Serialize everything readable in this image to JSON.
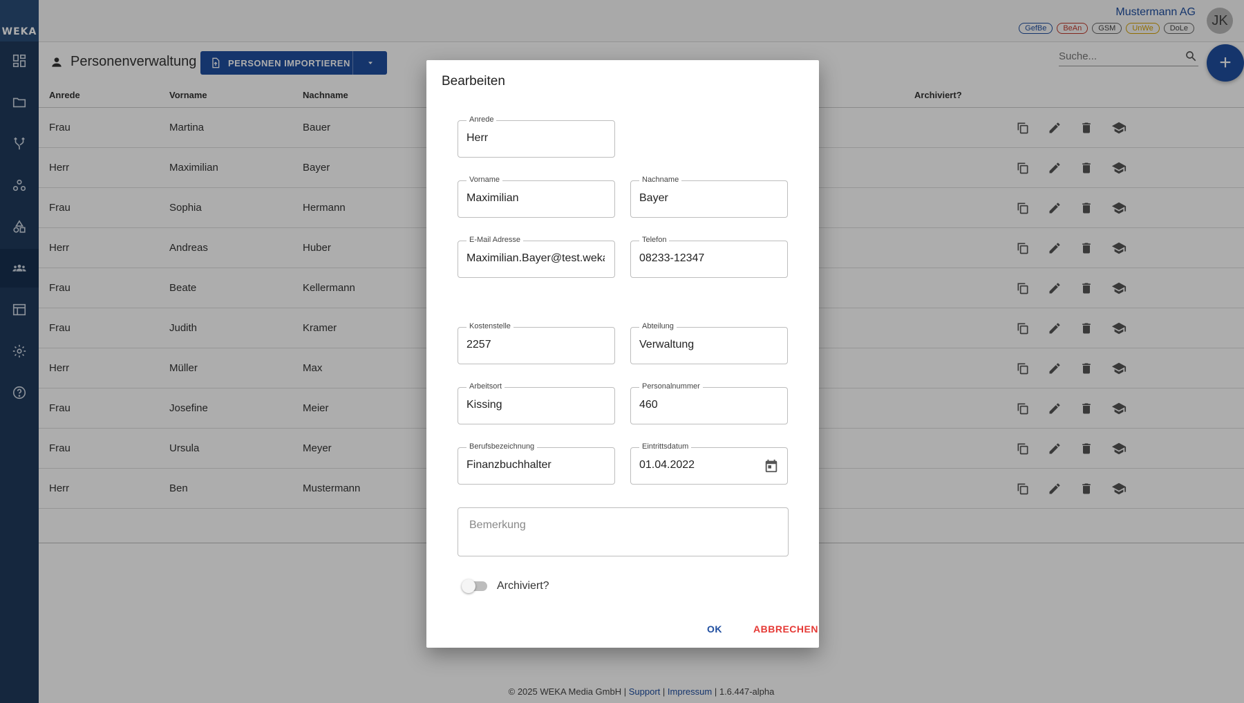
{
  "app": {
    "logo": "WEKA"
  },
  "topbar": {
    "company": "Mustermann AG",
    "badges": [
      {
        "label": "GefBe",
        "color": "#1f4ea0"
      },
      {
        "label": "BeAn",
        "color": "#c0392b"
      },
      {
        "label": "GSM",
        "color": "#444444"
      },
      {
        "label": "UnWe",
        "color": "#d4a100"
      },
      {
        "label": "DoLe",
        "color": "#444444"
      }
    ],
    "avatar": "JK"
  },
  "sidebar": {
    "items": [
      {
        "icon": "dashboard-icon"
      },
      {
        "icon": "folder-icon"
      },
      {
        "icon": "fork-icon"
      },
      {
        "icon": "bubbles-icon"
      },
      {
        "icon": "shapes-icon"
      },
      {
        "icon": "people-icon",
        "active": true
      },
      {
        "icon": "table-icon"
      },
      {
        "icon": "gear-icon"
      },
      {
        "icon": "help-icon"
      }
    ]
  },
  "header": {
    "title": "Personenverwaltung",
    "import_label": "PERSONEN IMPORTIEREN",
    "search_placeholder": "Suche..."
  },
  "table": {
    "columns": [
      "Anrede",
      "Vorname",
      "Nachname",
      "Archiviert?"
    ],
    "rows": [
      [
        "Frau",
        "Martina",
        "Bauer"
      ],
      [
        "Herr",
        "Maximilian",
        "Bayer"
      ],
      [
        "Frau",
        "Sophia",
        "Hermann"
      ],
      [
        "Herr",
        "Andreas",
        "Huber"
      ],
      [
        "Frau",
        "Beate",
        "Kellermann"
      ],
      [
        "Frau",
        "Judith",
        "Kramer"
      ],
      [
        "Herr",
        "Müller",
        "Max"
      ],
      [
        "Frau",
        "Josefine",
        "Meier"
      ],
      [
        "Frau",
        "Ursula",
        "Meyer"
      ],
      [
        "Herr",
        "Ben",
        "Mustermann"
      ]
    ]
  },
  "footer": {
    "copyright": "© 2025 WEKA Media GmbH |",
    "support": "Support",
    "sep": "|",
    "impressum": "Impressum",
    "version": "| 1.6.447-alpha"
  },
  "dialog": {
    "title": "Bearbeiten",
    "fields": {
      "anrede": {
        "label": "Anrede",
        "value": "Herr"
      },
      "vorname": {
        "label": "Vorname",
        "value": "Maximilian"
      },
      "nachname": {
        "label": "Nachname",
        "value": "Bayer"
      },
      "email": {
        "label": "E-Mail Adresse",
        "value": "Maximilian.Bayer@test.weka.de"
      },
      "telefon": {
        "label": "Telefon",
        "value": "08233-12347"
      },
      "kostenstelle": {
        "label": "Kostenstelle",
        "value": "2257"
      },
      "abteilung": {
        "label": "Abteilung",
        "value": "Verwaltung"
      },
      "arbeitsort": {
        "label": "Arbeitsort",
        "value": "Kissing"
      },
      "personalnummer": {
        "label": "Personalnummer",
        "value": "460"
      },
      "berufsbezeichnung": {
        "label": "Berufsbezeichnung",
        "value": "Finanzbuchhalter"
      },
      "eintrittsdatum": {
        "label": "Eintrittsdatum",
        "value": "01.04.2022"
      }
    },
    "remark_placeholder": "Bemerkung",
    "archived_label": "Archiviert?",
    "archived": false,
    "ok_label": "OK",
    "cancel_label": "ABBRECHEN"
  }
}
